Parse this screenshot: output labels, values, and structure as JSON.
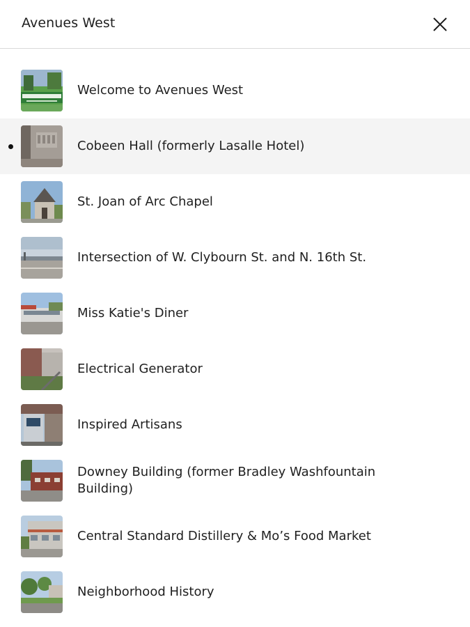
{
  "header": {
    "title": "Avenues West"
  },
  "items": [
    {
      "label": "Welcome to Avenues West",
      "active": false,
      "thumb_icon": "welcome-sign-photo"
    },
    {
      "label": "Cobeen Hall (formerly Lasalle Hotel)",
      "active": true,
      "thumb_icon": "building-sign-photo"
    },
    {
      "label": "St. Joan of Arc Chapel",
      "active": false,
      "thumb_icon": "chapel-photo"
    },
    {
      "label": "Intersection of W. Clybourn St. and N. 16th St.",
      "active": false,
      "thumb_icon": "street-intersection-photo"
    },
    {
      "label": "Miss Katie's Diner",
      "active": false,
      "thumb_icon": "diner-photo"
    },
    {
      "label": "Electrical Generator",
      "active": false,
      "thumb_icon": "generator-photo"
    },
    {
      "label": "Inspired Artisans",
      "active": false,
      "thumb_icon": "storefront-photo"
    },
    {
      "label": "Downey Building (former Bradley Washfountain Building)",
      "active": false,
      "thumb_icon": "brick-building-photo"
    },
    {
      "label": "Central Standard Distillery & Mo’s Food Market",
      "active": false,
      "thumb_icon": "distillery-photo"
    },
    {
      "label": "Neighborhood History",
      "active": false,
      "thumb_icon": "neighborhood-street-photo"
    }
  ]
}
